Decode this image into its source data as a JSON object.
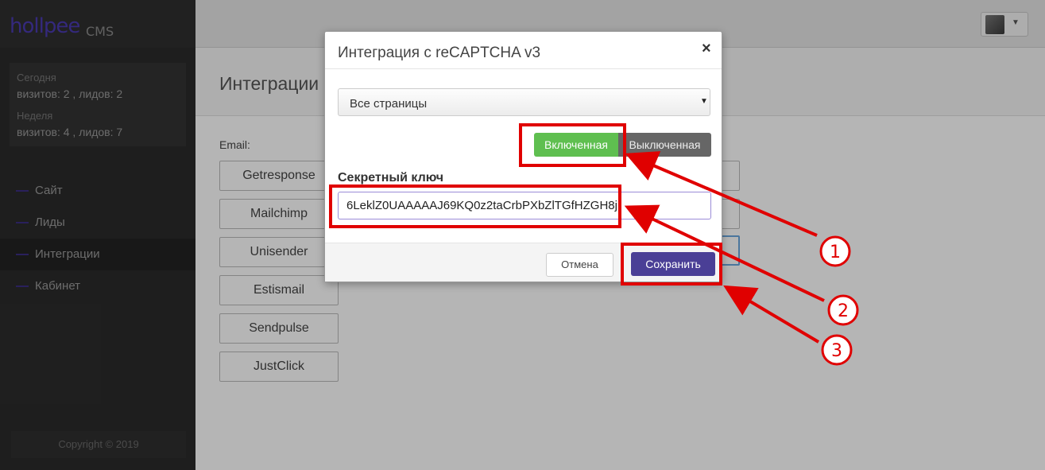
{
  "brand": {
    "logo": "hollpee",
    "suffix": "CMS"
  },
  "stats": {
    "today_label": "Сегодня",
    "today_value": "визитов: 2 , лидов: 2",
    "week_label": "Неделя",
    "week_value": "визитов: 4 , лидов: 7"
  },
  "sidebar": {
    "items": [
      {
        "label": "Сайт"
      },
      {
        "label": "Лиды"
      },
      {
        "label": "Интеграции"
      },
      {
        "label": "Кабинет"
      }
    ],
    "copyright": "Copyright © 2019"
  },
  "page": {
    "title": "Интеграции",
    "email_label": "Email:",
    "integrations": [
      {
        "label": "Getresponse"
      },
      {
        "label": "Mailchimp"
      },
      {
        "label": "Unisender"
      },
      {
        "label": "Estismail"
      },
      {
        "label": "Sendpulse"
      },
      {
        "label": "JustClick"
      }
    ]
  },
  "modal": {
    "title": "Интеграция с reCAPTCHA v3",
    "close": "×",
    "select_value": "Все страницы",
    "toggle_on": "Включенная",
    "toggle_off": "Выключенная",
    "secret_label": "Секретный ключ",
    "secret_value": "6LeklZ0UAAAAAJ69KQ0z2taCrbPXbZlTGfHZGH8j",
    "cancel": "Отмена",
    "save": "Сохранить"
  },
  "annotations": [
    {
      "number": "1"
    },
    {
      "number": "2"
    },
    {
      "number": "3"
    }
  ],
  "colors": {
    "annotation": "#e00000",
    "toggle_on": "#5fbf50",
    "save_button": "#4a3f96"
  },
  "icons": [
    "close-icon",
    "select-caret-icon",
    "avatar-caret-icon"
  ]
}
